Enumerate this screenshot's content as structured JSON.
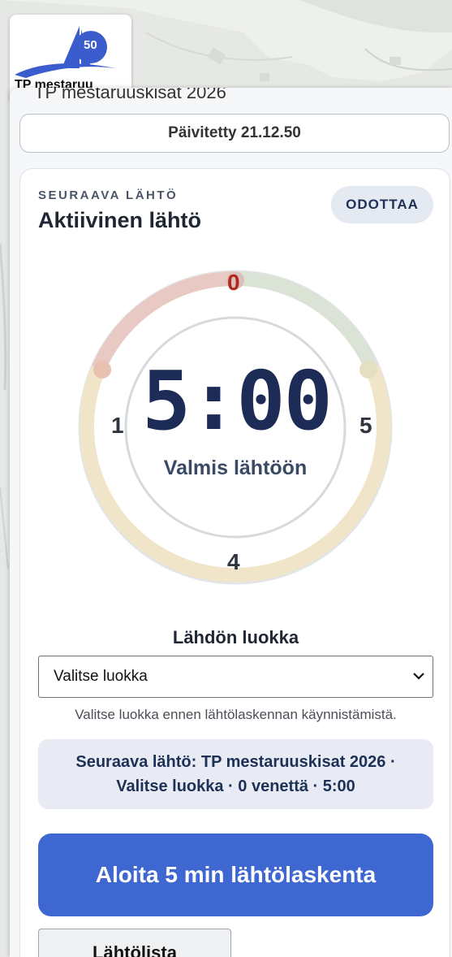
{
  "logo": {
    "badge_number": "50",
    "name": "TP mestaruu"
  },
  "event": {
    "title": "TP mestaruuskisat 2026"
  },
  "updated": {
    "label": "Päivitetty 21.12.50"
  },
  "start_card": {
    "eyebrow": "SEURAAVA LÄHTÖ",
    "title": "Aktiivinen lähtö",
    "status": "ODOTTAA",
    "timer": "5:00",
    "timer_caption": "Valmis lähtöön",
    "ticks": {
      "top": "0",
      "right": "5",
      "bottom": "4",
      "left": "1"
    },
    "colors": {
      "red_segment": "#e8c9c4",
      "green_segment": "#dbe3d6",
      "yellow_segment": "#f1e5c9",
      "zero_mark": "#b3261e"
    }
  },
  "class_picker": {
    "label": "Lähdön luokka",
    "selected": "Valitse luokka",
    "hint": "Valitse luokka ennen lähtölaskennan käynnistämistä."
  },
  "next_start": {
    "summary": "Seuraava lähtö: TP mestaruuskisat 2026 · Valitse luokka · 0 venettä · 5:00"
  },
  "actions": {
    "start_label": "Aloita 5 min lähtölaskenta",
    "secondary_label": "Lähtölista",
    "accent": "#3f67d1"
  }
}
